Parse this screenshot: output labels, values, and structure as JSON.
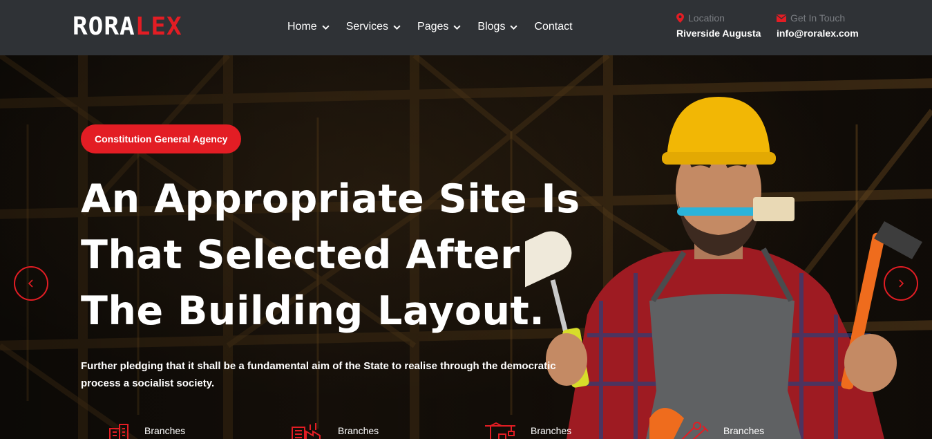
{
  "brand": {
    "logo_part1": "RORA",
    "logo_part2": "LEX",
    "accent_color": "#e31d24"
  },
  "nav": {
    "items": [
      {
        "label": "Home",
        "has_dropdown": true
      },
      {
        "label": "Services",
        "has_dropdown": true
      },
      {
        "label": "Pages",
        "has_dropdown": true
      },
      {
        "label": "Blogs",
        "has_dropdown": true
      },
      {
        "label": "Contact",
        "has_dropdown": false
      }
    ]
  },
  "contact": {
    "location_label": "Location",
    "location_value": "Riverside Augusta",
    "touch_label": "Get In Touch",
    "touch_value": "info@roralex.com",
    "location_icon": "map-pin-icon",
    "touch_icon": "envelope-icon"
  },
  "hero": {
    "tag": "Constitution General Agency",
    "headline_line1": "An Appropriate Site Is",
    "headline_line2": "That Selected After",
    "headline_line3": "The Building Layout.",
    "subtext_line1": "Further pledging that it shall be a fundamental aim of the State to realise through the democratic",
    "subtext_line2": "process a socialist society."
  },
  "branches": [
    {
      "label": "Branches",
      "icon": "building-icon"
    },
    {
      "label": "Branches",
      "icon": "factory-icon"
    },
    {
      "label": "Branches",
      "icon": "crane-icon"
    },
    {
      "label": "Branches",
      "icon": "tools-icon"
    }
  ]
}
